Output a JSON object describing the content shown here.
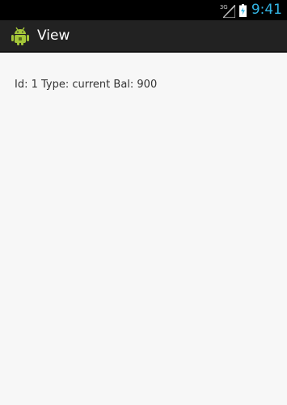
{
  "status_bar": {
    "network_type": "3G",
    "time": "9:41",
    "icons": [
      "signal-icon",
      "battery-icon"
    ]
  },
  "action_bar": {
    "icon": "android-icon",
    "title": "View"
  },
  "content": {
    "record_text": "Id: 1 Type: current Bal: 900"
  },
  "colors": {
    "status_bar_bg": "#000000",
    "action_bar_bg": "#222222",
    "clock": "#33b5e5",
    "content_bg": "#f7f7f7",
    "android_green": "#a4c639"
  }
}
